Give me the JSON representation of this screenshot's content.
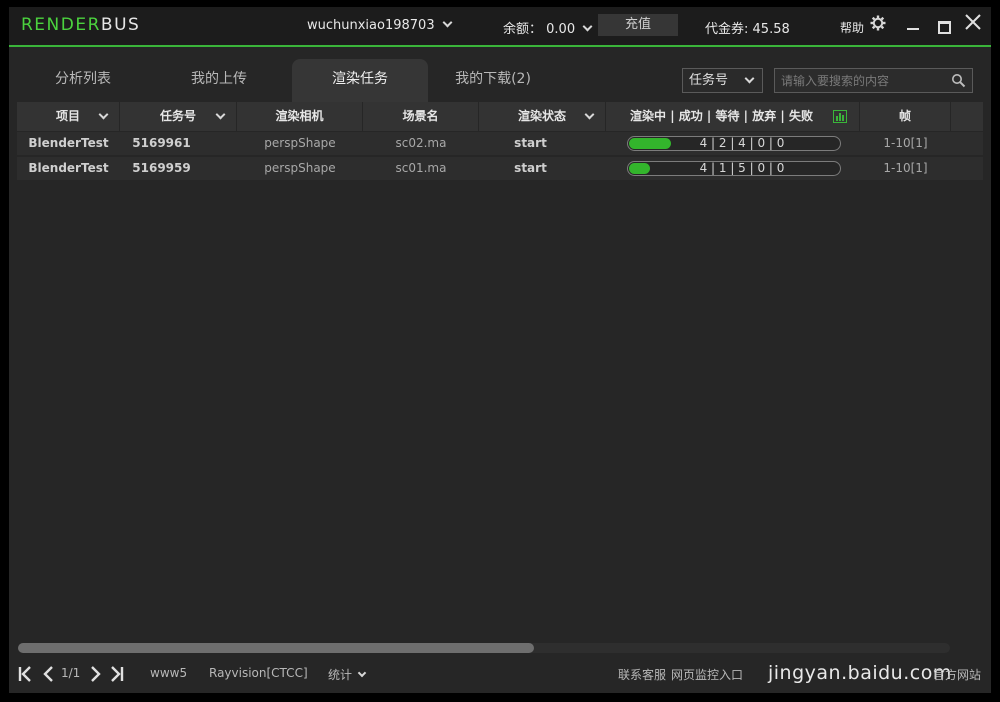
{
  "app": {
    "logo_part1": "RENDER",
    "logo_part2": "BUS",
    "username": "wuchunxiao198703",
    "balance_label": "余额：",
    "balance_value": "0.00",
    "recharge_label": "充值",
    "voucher_label": "代金券:",
    "voucher_value": "45.58",
    "help_label": "帮助"
  },
  "tabs": [
    {
      "label": "分析列表",
      "active": false
    },
    {
      "label": "我的上传",
      "active": false
    },
    {
      "label": "渲染任务",
      "active": true
    },
    {
      "label": "我的下载(2)",
      "active": false
    }
  ],
  "search": {
    "type_selected": "任务号",
    "placeholder": "请输入要搜索的内容"
  },
  "table": {
    "columns": [
      "项目",
      "任务号",
      "渲染相机",
      "场景名",
      "渲染状态",
      "渲染中 | 成功 | 等待 | 放弃 | 失败",
      "帧"
    ],
    "rows": [
      {
        "project": "BlenderTest",
        "task_id": "5169961",
        "camera": "perspShape",
        "scene": "sc02.ma",
        "status": "start",
        "progress_text": "4 | 2 | 4 | 0 | 0",
        "progress": 0.2,
        "frames": "1-10[1]"
      },
      {
        "project": "BlenderTest",
        "task_id": "5169959",
        "camera": "perspShape",
        "scene": "sc01.ma",
        "status": "start",
        "progress_text": "4 | 1 | 5 | 0 | 0",
        "progress": 0.1,
        "frames": "1-10[1]"
      }
    ]
  },
  "footer": {
    "page": "1/1",
    "server": "www5",
    "platform": "Rayvision[CTCC]",
    "stats_label": "统计",
    "support": "联系客服",
    "monitor": "网页监控入口",
    "official": "官方网站",
    "watermark": "jingyan.baidu.com"
  },
  "colors": {
    "accent": "#3ab53a",
    "progress_fill": "#33b52c",
    "background": "#262626"
  },
  "icons": [
    "chevron-down-icon",
    "gear-icon",
    "minimize-icon",
    "maximize-icon",
    "close-icon",
    "search-icon",
    "bar-chart-icon",
    "first-page-icon",
    "prev-page-icon",
    "next-page-icon",
    "last-page-icon"
  ]
}
